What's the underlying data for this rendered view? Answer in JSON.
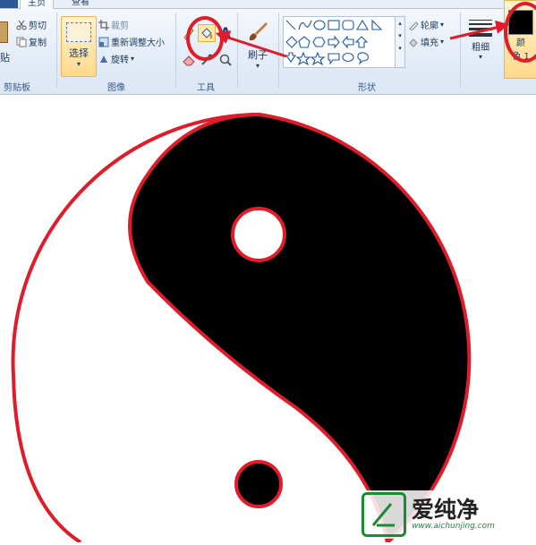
{
  "tabs": {
    "home": "主页",
    "view": "查看"
  },
  "clipboard": {
    "paste_partial": "贴",
    "cut": "剪切",
    "copy": "复制",
    "group_label": "剪贴板"
  },
  "image": {
    "select": "选择",
    "crop": "裁剪",
    "resize": "重新调整大小",
    "rotate": "旋转",
    "group_label": "图像"
  },
  "tools": {
    "text_tool": "A",
    "group_label": "工具"
  },
  "brush": {
    "label": "刷子"
  },
  "shapes": {
    "outline": "轮廓",
    "fill": "填充",
    "group_label": "形状"
  },
  "size": {
    "label": "粗细"
  },
  "color1": {
    "label": "色 1",
    "top_partial": "颜",
    "value": "#000000"
  },
  "annotation_color": "#e11c2a",
  "canvas": {
    "image": "yin-yang drawing",
    "fill": "#000000",
    "background": "#ffffff",
    "outline": "#e11c2a"
  },
  "watermark": {
    "brand": "爱纯净",
    "url": "www.aichunjing.com"
  },
  "icons": [
    "cut-icon",
    "copy-icon",
    "crop-icon",
    "resize-icon",
    "rotate-icon",
    "pencil-icon",
    "fill-bucket-icon",
    "text-icon",
    "eraser-icon",
    "color-picker-icon",
    "magnifier-icon",
    "brush-icon",
    "outline-icon",
    "fill-icon"
  ]
}
